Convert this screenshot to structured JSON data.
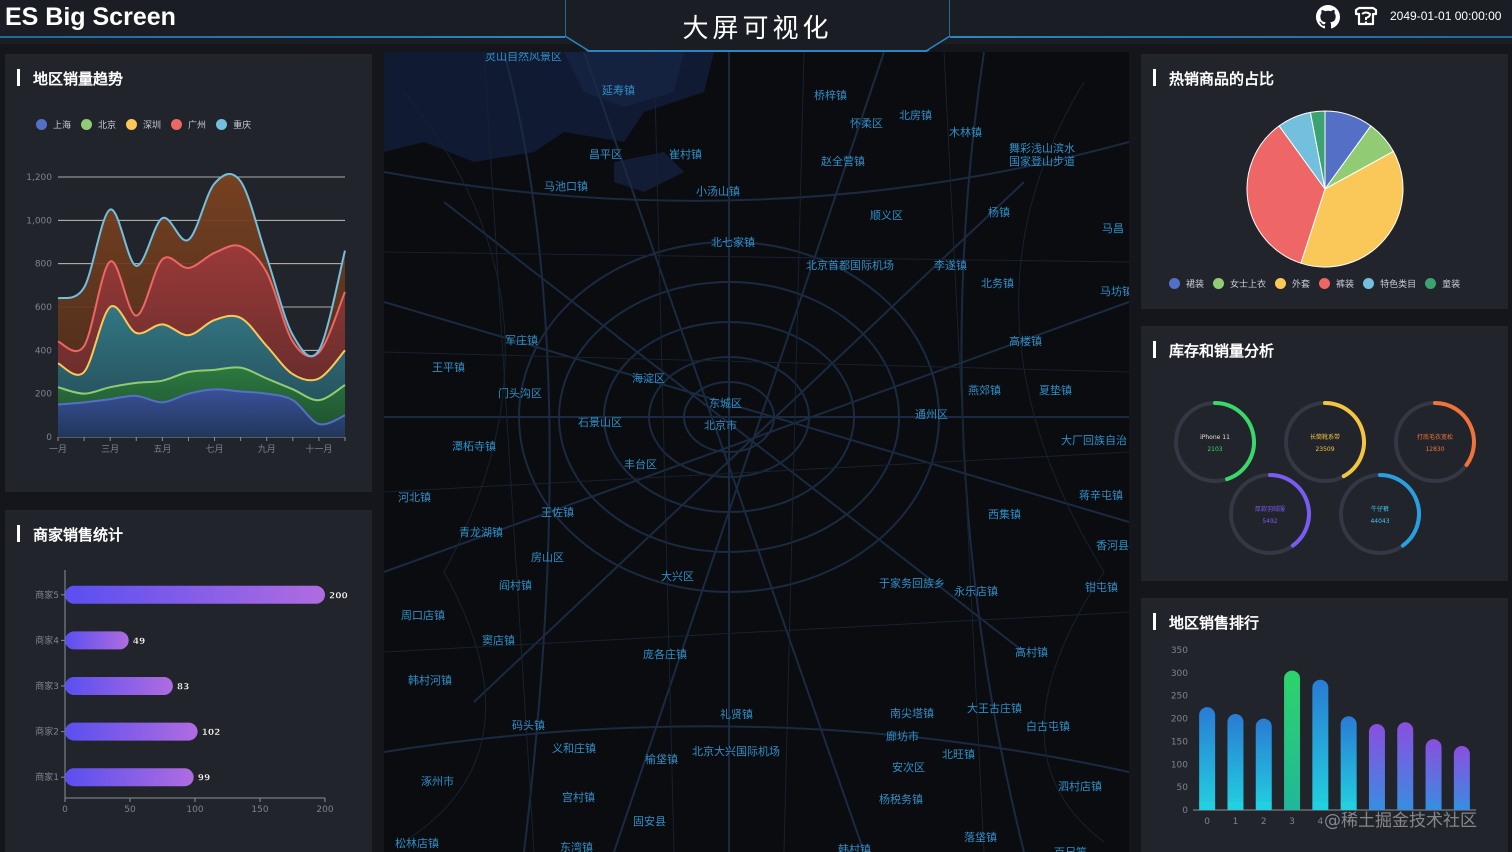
{
  "header": {
    "app_title": "ES Big Screen",
    "screen_title": "大屏可视化",
    "datetime": "2049-01-01 00:00:00",
    "icons": [
      "github-icon",
      "faq-icon"
    ]
  },
  "region_trend": {
    "title": "地区销量趋势",
    "legend": [
      {
        "label": "上海",
        "color": "#5470c6"
      },
      {
        "label": "北京",
        "color": "#91cc75"
      },
      {
        "label": "深圳",
        "color": "#fac858"
      },
      {
        "label": "广州",
        "color": "#ee6666"
      },
      {
        "label": "重庆",
        "color": "#73c0de"
      }
    ]
  },
  "merchant": {
    "title": "商家销售统计"
  },
  "hot_goods": {
    "title": "热销商品的占比",
    "legend": [
      {
        "label": "裙装",
        "color": "#5470c6"
      },
      {
        "label": "女士上衣",
        "color": "#91cc75"
      },
      {
        "label": "外套",
        "color": "#fac858"
      },
      {
        "label": "裤装",
        "color": "#ee6666"
      },
      {
        "label": "特色类目",
        "color": "#73c0de"
      },
      {
        "label": "童装",
        "color": "#3ba272"
      }
    ]
  },
  "inventory": {
    "title": "库存和销量分析",
    "rings": [
      {
        "name": "iPhone 11",
        "value": "2103",
        "fraction": 0.45,
        "color": "#3ad86a",
        "text_color": "#e0e0e0",
        "value_color": "#3ad86a"
      },
      {
        "name": "长筒靴系带",
        "value": "23509",
        "fraction": 0.42,
        "color": "#f4c542",
        "text_color": "#f4c542",
        "value_color": "#f4c542"
      },
      {
        "name": "打底毛衣宽松",
        "value": "12830",
        "fraction": 0.35,
        "color": "#f0743a",
        "text_color": "#f0743a",
        "value_color": "#f0743a"
      },
      {
        "name": "厚款羽绒服",
        "value": "5492",
        "fraction": 0.4,
        "color": "#7a5cf0",
        "text_color": "#7a5cf0",
        "value_color": "#7a5cf0"
      },
      {
        "name": "牛仔裤",
        "value": "44043",
        "fraction": 0.4,
        "color": "#2a9fe0",
        "text_color": "#40c8f0",
        "value_color": "#40c8f0"
      }
    ]
  },
  "region_rank": {
    "title": "地区销售排行"
  },
  "map": {
    "labels": [
      {
        "text": "怀柔区"
      },
      {
        "text": "北房镇"
      },
      {
        "text": "延寿镇"
      },
      {
        "text": "桥梓镇"
      },
      {
        "text": "木林镇"
      },
      {
        "text": "舞彩浅山滨水"
      },
      {
        "text": "国家登山步道"
      },
      {
        "text": "昌平区"
      },
      {
        "text": "崔村镇"
      },
      {
        "text": "赵全营镇"
      },
      {
        "text": "马池口镇"
      },
      {
        "text": "小汤山镇"
      },
      {
        "text": "顺义区"
      },
      {
        "text": "杨镇"
      },
      {
        "text": "马昌"
      },
      {
        "text": "北七家镇"
      },
      {
        "text": "北京首都国际机场"
      },
      {
        "text": "李遂镇"
      },
      {
        "text": "北务镇"
      },
      {
        "text": "马坊镇"
      },
      {
        "text": "军庄镇"
      },
      {
        "text": "高楼镇"
      },
      {
        "text": "王平镇"
      },
      {
        "text": "海淀区"
      },
      {
        "text": "门头沟区"
      },
      {
        "text": "东城区"
      },
      {
        "text": "燕郊镇"
      },
      {
        "text": "夏垫镇"
      },
      {
        "text": "石景山区"
      },
      {
        "text": "北京市"
      },
      {
        "text": "通州区"
      },
      {
        "text": "潭柘寺镇"
      },
      {
        "text": "大厂回族自治"
      },
      {
        "text": "丰台区"
      },
      {
        "text": "河北镇"
      },
      {
        "text": "蒋辛屯镇"
      },
      {
        "text": "王佐镇"
      },
      {
        "text": "西集镇"
      },
      {
        "text": "青龙湖镇"
      },
      {
        "text": "香河县"
      },
      {
        "text": "房山区"
      },
      {
        "text": "大兴区"
      },
      {
        "text": "于家务回族乡"
      },
      {
        "text": "阎村镇"
      },
      {
        "text": "永乐店镇"
      },
      {
        "text": "钳屯镇"
      },
      {
        "text": "周口店镇"
      },
      {
        "text": "窦店镇"
      },
      {
        "text": "庞各庄镇"
      },
      {
        "text": "高村镇"
      },
      {
        "text": "韩村河镇"
      },
      {
        "text": "大王古庄镇"
      },
      {
        "text": "礼贤镇"
      },
      {
        "text": "南尖塔镇"
      },
      {
        "text": "码头镇"
      },
      {
        "text": "白古屯镇"
      },
      {
        "text": "廊坊市"
      },
      {
        "text": "义和庄镇"
      },
      {
        "text": "北京大兴国际机场"
      },
      {
        "text": "北旺镇"
      },
      {
        "text": "榆垡镇"
      },
      {
        "text": "安次区"
      },
      {
        "text": "涿州市"
      },
      {
        "text": "泗村店镇"
      },
      {
        "text": "杨税务镇"
      },
      {
        "text": "宫村镇"
      },
      {
        "text": "固安县"
      },
      {
        "text": "落垡镇"
      },
      {
        "text": "松林店镇"
      },
      {
        "text": "东湾镇"
      },
      {
        "text": "韩村镇"
      },
      {
        "text": "百尺竿"
      },
      {
        "text": "灵山自然风景区"
      }
    ]
  },
  "watermark": "@稀土掘金技术社区",
  "chart_data": [
    {
      "type": "area",
      "title": "",
      "x": [
        "一月",
        "二月",
        "三月",
        "四月",
        "五月",
        "六月",
        "七月",
        "八月",
        "九月",
        "十月",
        "十一月",
        "十二月"
      ],
      "x_tick_labels": [
        "一月",
        "三月",
        "五月",
        "七月",
        "九月",
        "十一月"
      ],
      "ylim": [
        0,
        1200
      ],
      "y_ticks": [
        0,
        200,
        400,
        600,
        800,
        1000,
        1200
      ],
      "stacked_display": false,
      "series": [
        {
          "name": "上海",
          "color": "#5470c6",
          "values": [
            150,
            160,
            175,
            190,
            160,
            200,
            220,
            210,
            200,
            170,
            60,
            100
          ]
        },
        {
          "name": "北京",
          "color": "#91cc75",
          "values": [
            230,
            200,
            230,
            250,
            260,
            300,
            310,
            320,
            270,
            220,
            170,
            240
          ]
        },
        {
          "name": "深圳",
          "color": "#fac858",
          "values": [
            340,
            300,
            600,
            480,
            520,
            470,
            540,
            550,
            420,
            290,
            270,
            400
          ]
        },
        {
          "name": "广州",
          "color": "#ee6666",
          "values": [
            440,
            420,
            810,
            560,
            820,
            780,
            850,
            880,
            760,
            440,
            390,
            670
          ]
        },
        {
          "name": "重庆",
          "color": "#73c0de",
          "values": [
            640,
            690,
            1050,
            790,
            1010,
            910,
            1170,
            1180,
            830,
            470,
            400,
            860
          ]
        }
      ]
    },
    {
      "type": "bar",
      "orientation": "horizontal",
      "title": "",
      "categories": [
        "商家1",
        "商家2",
        "商家3",
        "商家4",
        "商家5"
      ],
      "values": [
        99,
        102,
        83,
        49,
        200
      ],
      "xlim": [
        0,
        200
      ],
      "x_ticks": [
        0,
        50,
        100,
        150,
        200
      ]
    },
    {
      "type": "pie",
      "title": "",
      "slices": [
        {
          "name": "裙装",
          "value": 10,
          "color": "#5470c6"
        },
        {
          "name": "女士上衣",
          "value": 7,
          "color": "#91cc75"
        },
        {
          "name": "外套",
          "value": 38,
          "color": "#fac858"
        },
        {
          "name": "裤装",
          "value": 35,
          "color": "#ee6666"
        },
        {
          "name": "特色类目",
          "value": 7,
          "color": "#73c0de"
        },
        {
          "name": "童装",
          "value": 3,
          "color": "#3ba272"
        }
      ]
    },
    {
      "type": "bar",
      "title": "",
      "categories": [
        "0",
        "1",
        "2",
        "3",
        "4",
        "5",
        "6",
        "7",
        "8",
        "9"
      ],
      "values": [
        225,
        210,
        200,
        305,
        285,
        205,
        188,
        192,
        155,
        140
      ],
      "highlight_index": 3,
      "ylim": [
        0,
        350
      ],
      "y_ticks": [
        0,
        50,
        100,
        150,
        200,
        250,
        300,
        350
      ]
    }
  ]
}
